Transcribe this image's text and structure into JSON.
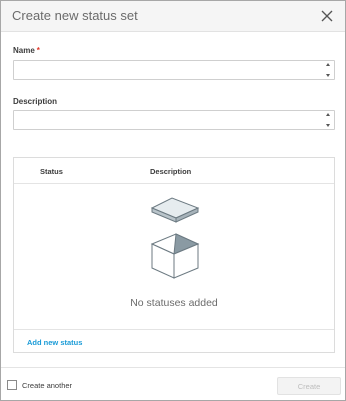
{
  "dialog": {
    "title": "Create new status set",
    "close_icon": "close-icon"
  },
  "form": {
    "name_label": "Name",
    "required_marker": "*",
    "name_value": "",
    "name_placeholder": "",
    "description_label": "Description",
    "description_value": "",
    "description_placeholder": ""
  },
  "table": {
    "columns": [
      "Status",
      "Description"
    ],
    "empty_icon": "empty-box-icon",
    "empty_text": "No statuses added",
    "add_link": "Add new status"
  },
  "footer": {
    "create_another_label": "Create another",
    "create_another_checked": false,
    "create_button": "Create"
  },
  "colors": {
    "accent_link": "#1a9bd7",
    "required": "#e2382a",
    "header_bg": "#f5f5f5"
  }
}
